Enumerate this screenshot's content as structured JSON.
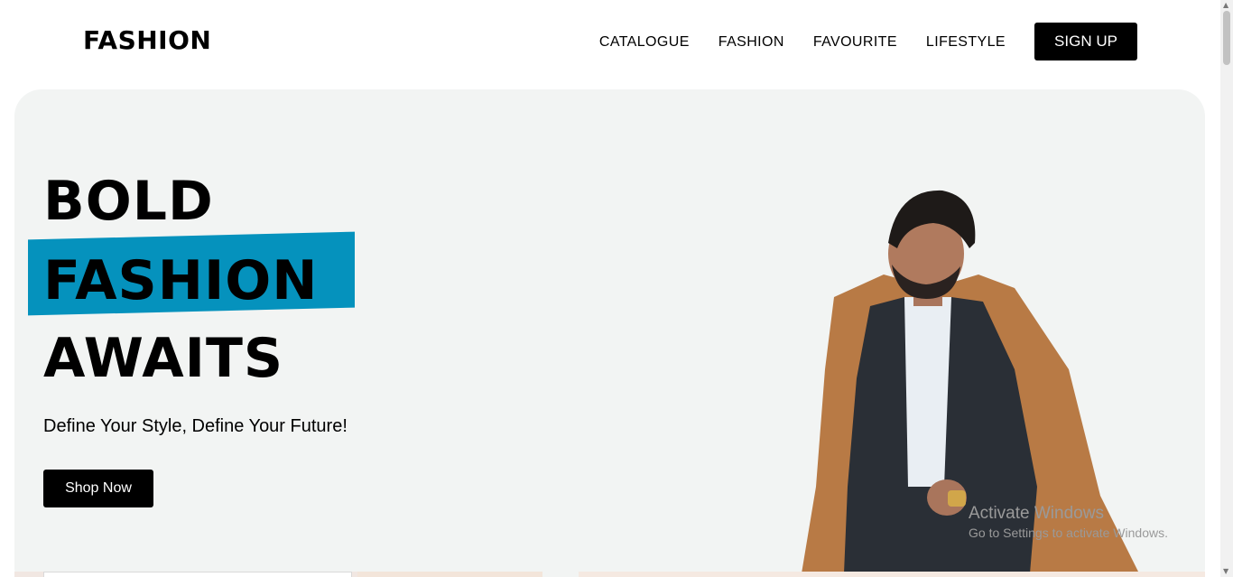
{
  "brand": {
    "logo": "FASHION"
  },
  "nav": {
    "links": [
      "CATALOGUE",
      "FASHION",
      "FAVOURITE",
      "LIFESTYLE"
    ],
    "signup_label": "SIGN UP"
  },
  "hero": {
    "line1": "BOLD",
    "line2": "FASHION",
    "line3": "AWAITS",
    "subtitle": "Define Your Style, Define Your Future!",
    "cta_label": "Shop Now",
    "accent_color": "#0592bd",
    "background_color": "#f2f4f3"
  },
  "watermark": {
    "title": "Activate Windows",
    "subtitle": "Go to Settings to activate Windows."
  }
}
